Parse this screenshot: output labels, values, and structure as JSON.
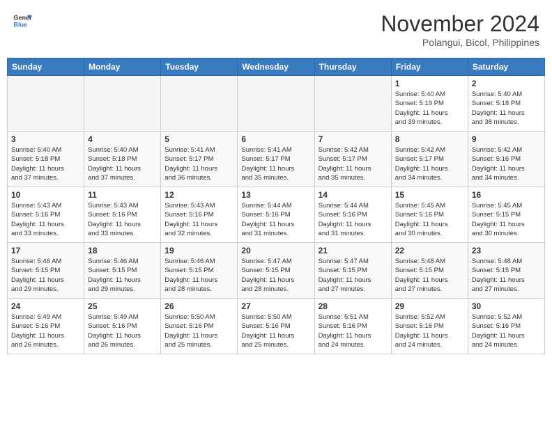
{
  "header": {
    "logo_line1": "General",
    "logo_line2": "Blue",
    "month": "November 2024",
    "location": "Polangui, Bicol, Philippines"
  },
  "weekdays": [
    "Sunday",
    "Monday",
    "Tuesday",
    "Wednesday",
    "Thursday",
    "Friday",
    "Saturday"
  ],
  "weeks": [
    [
      {
        "day": "",
        "info": ""
      },
      {
        "day": "",
        "info": ""
      },
      {
        "day": "",
        "info": ""
      },
      {
        "day": "",
        "info": ""
      },
      {
        "day": "",
        "info": ""
      },
      {
        "day": "1",
        "info": "Sunrise: 5:40 AM\nSunset: 5:19 PM\nDaylight: 11 hours\nand 39 minutes."
      },
      {
        "day": "2",
        "info": "Sunrise: 5:40 AM\nSunset: 5:18 PM\nDaylight: 11 hours\nand 38 minutes."
      }
    ],
    [
      {
        "day": "3",
        "info": "Sunrise: 5:40 AM\nSunset: 5:18 PM\nDaylight: 11 hours\nand 37 minutes."
      },
      {
        "day": "4",
        "info": "Sunrise: 5:40 AM\nSunset: 5:18 PM\nDaylight: 11 hours\nand 37 minutes."
      },
      {
        "day": "5",
        "info": "Sunrise: 5:41 AM\nSunset: 5:17 PM\nDaylight: 11 hours\nand 36 minutes."
      },
      {
        "day": "6",
        "info": "Sunrise: 5:41 AM\nSunset: 5:17 PM\nDaylight: 11 hours\nand 35 minutes."
      },
      {
        "day": "7",
        "info": "Sunrise: 5:42 AM\nSunset: 5:17 PM\nDaylight: 11 hours\nand 35 minutes."
      },
      {
        "day": "8",
        "info": "Sunrise: 5:42 AM\nSunset: 5:17 PM\nDaylight: 11 hours\nand 34 minutes."
      },
      {
        "day": "9",
        "info": "Sunrise: 5:42 AM\nSunset: 5:16 PM\nDaylight: 11 hours\nand 34 minutes."
      }
    ],
    [
      {
        "day": "10",
        "info": "Sunrise: 5:43 AM\nSunset: 5:16 PM\nDaylight: 11 hours\nand 33 minutes."
      },
      {
        "day": "11",
        "info": "Sunrise: 5:43 AM\nSunset: 5:16 PM\nDaylight: 11 hours\nand 33 minutes."
      },
      {
        "day": "12",
        "info": "Sunrise: 5:43 AM\nSunset: 5:16 PM\nDaylight: 11 hours\nand 32 minutes."
      },
      {
        "day": "13",
        "info": "Sunrise: 5:44 AM\nSunset: 5:16 PM\nDaylight: 11 hours\nand 31 minutes."
      },
      {
        "day": "14",
        "info": "Sunrise: 5:44 AM\nSunset: 5:16 PM\nDaylight: 11 hours\nand 31 minutes."
      },
      {
        "day": "15",
        "info": "Sunrise: 5:45 AM\nSunset: 5:16 PM\nDaylight: 11 hours\nand 30 minutes."
      },
      {
        "day": "16",
        "info": "Sunrise: 5:45 AM\nSunset: 5:15 PM\nDaylight: 11 hours\nand 30 minutes."
      }
    ],
    [
      {
        "day": "17",
        "info": "Sunrise: 5:46 AM\nSunset: 5:15 PM\nDaylight: 11 hours\nand 29 minutes."
      },
      {
        "day": "18",
        "info": "Sunrise: 5:46 AM\nSunset: 5:15 PM\nDaylight: 11 hours\nand 29 minutes."
      },
      {
        "day": "19",
        "info": "Sunrise: 5:46 AM\nSunset: 5:15 PM\nDaylight: 11 hours\nand 28 minutes."
      },
      {
        "day": "20",
        "info": "Sunrise: 5:47 AM\nSunset: 5:15 PM\nDaylight: 11 hours\nand 28 minutes."
      },
      {
        "day": "21",
        "info": "Sunrise: 5:47 AM\nSunset: 5:15 PM\nDaylight: 11 hours\nand 27 minutes."
      },
      {
        "day": "22",
        "info": "Sunrise: 5:48 AM\nSunset: 5:15 PM\nDaylight: 11 hours\nand 27 minutes."
      },
      {
        "day": "23",
        "info": "Sunrise: 5:48 AM\nSunset: 5:15 PM\nDaylight: 11 hours\nand 27 minutes."
      }
    ],
    [
      {
        "day": "24",
        "info": "Sunrise: 5:49 AM\nSunset: 5:16 PM\nDaylight: 11 hours\nand 26 minutes."
      },
      {
        "day": "25",
        "info": "Sunrise: 5:49 AM\nSunset: 5:16 PM\nDaylight: 11 hours\nand 26 minutes."
      },
      {
        "day": "26",
        "info": "Sunrise: 5:50 AM\nSunset: 5:16 PM\nDaylight: 11 hours\nand 25 minutes."
      },
      {
        "day": "27",
        "info": "Sunrise: 5:50 AM\nSunset: 5:16 PM\nDaylight: 11 hours\nand 25 minutes."
      },
      {
        "day": "28",
        "info": "Sunrise: 5:51 AM\nSunset: 5:16 PM\nDaylight: 11 hours\nand 24 minutes."
      },
      {
        "day": "29",
        "info": "Sunrise: 5:52 AM\nSunset: 5:16 PM\nDaylight: 11 hours\nand 24 minutes."
      },
      {
        "day": "30",
        "info": "Sunrise: 5:52 AM\nSunset: 5:16 PM\nDaylight: 11 hours\nand 24 minutes."
      }
    ]
  ]
}
